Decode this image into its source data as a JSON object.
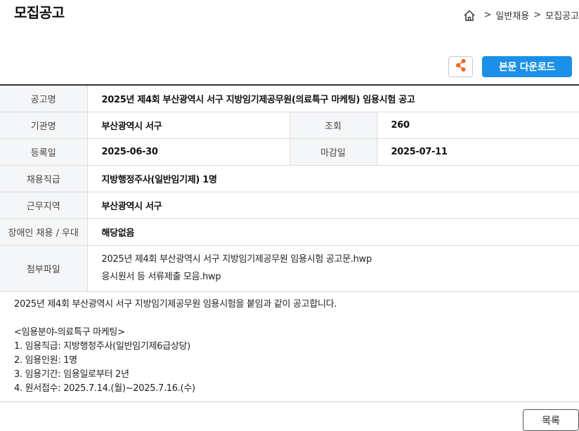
{
  "page_title": "모집공고",
  "breadcrumb": {
    "home_icon": "home-icon",
    "separator": ">",
    "items": [
      "일반채용",
      "모집공고"
    ]
  },
  "toolbar": {
    "share_icon": "share-icon",
    "download_label": "본문 다운로드",
    "accent_color": "#1b90e6",
    "share_icon_color": "#f26522"
  },
  "info": {
    "notice_name_label": "공고명",
    "notice_name": "2025년 제4회 부산광역시 서구 지방임기제공무원(의료특구 마케팅) 임용시험 공고",
    "agency_label": "기관명",
    "agency": "부산광역시 서구",
    "views_label": "조회",
    "views": "260",
    "registered_label": "등록일",
    "registered": "2025-06-30",
    "deadline_label": "마감일",
    "deadline": "2025-07-11",
    "grade_label": "채용직급",
    "grade": "지방행정주사(일반임기제) 1명",
    "region_label": "근무지역",
    "region": "부산광역시 서구",
    "disability_label": "장애인 채용 / 우대",
    "disability": "해당없음",
    "attachments_label": "첨부파일",
    "attachments": [
      "2025년 제4회 부산광역시 서구 지방임기제공무원 임용시험 공고문.hwp",
      "응시원서 등 서류제출 모음.hwp"
    ]
  },
  "body": {
    "intro": "2025년 제4회 부산광역시 서구 지방임기제공무원 임용시험을 붙임과 같이 공고합니다.",
    "section_title": "<임용분야-의료특구 마케팅>",
    "lines": [
      "1. 임용직급: 지방행정주사(일반임기제6급상당)",
      "2. 임용인원: 1명",
      "3. 임용기간: 임용일로부터 2년",
      "4. 원서접수: 2025.7.14.(월)~2025.7.16.(수)"
    ]
  },
  "footer": {
    "list_label": "목록"
  }
}
